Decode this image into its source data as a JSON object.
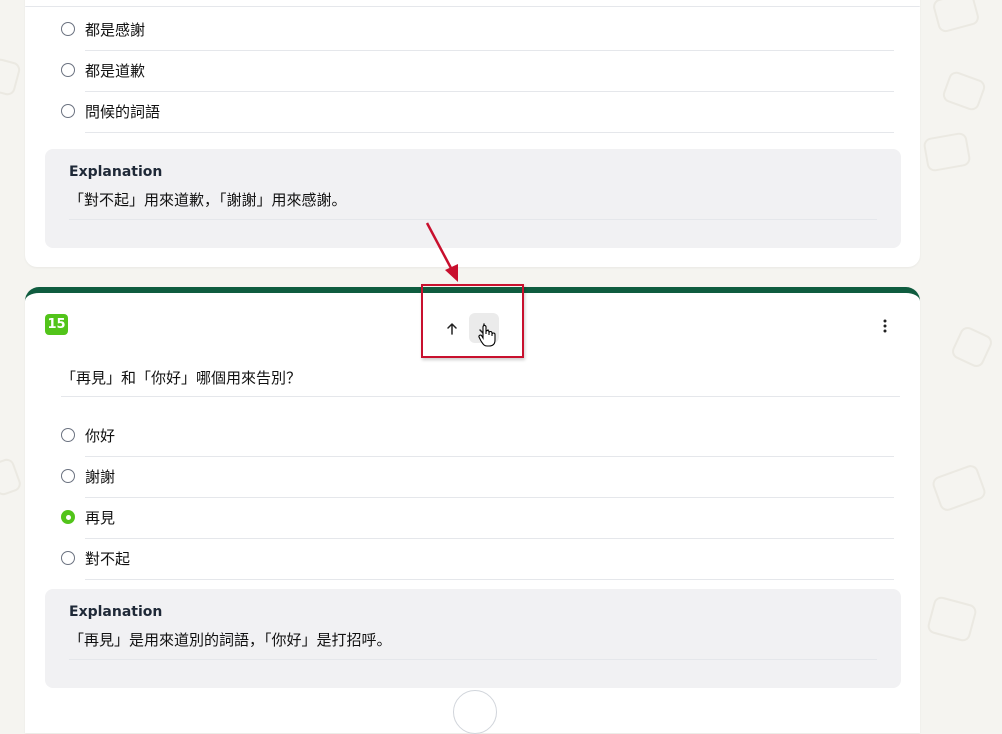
{
  "previous_question": {
    "options": [
      {
        "label": "都是感謝",
        "selected": false
      },
      {
        "label": "都是道歉",
        "selected": false
      },
      {
        "label": "問候的詞語",
        "selected": false
      }
    ],
    "explanation": {
      "title": "Explanation",
      "text": "「對不起」用來道歉，「謝謝」用來感謝。"
    }
  },
  "current_question": {
    "number": "15",
    "question": "「再見」和「你好」哪個用來告別？",
    "move_up_icon": "arrow-up-icon",
    "move_down_icon": "arrow-down-icon",
    "more_icon": "more-vertical-icon",
    "options": [
      {
        "label": "你好",
        "selected": false
      },
      {
        "label": "謝謝",
        "selected": false
      },
      {
        "label": "再見",
        "selected": true
      },
      {
        "label": "對不起",
        "selected": false
      }
    ],
    "explanation": {
      "title": "Explanation",
      "text": "「再見」是用來道別的詞語，「你好」是打招呼。"
    }
  },
  "colors": {
    "accent_green": "#52c41a",
    "header_bar": "#0f5c3f",
    "annotation_red": "#c8102e"
  }
}
